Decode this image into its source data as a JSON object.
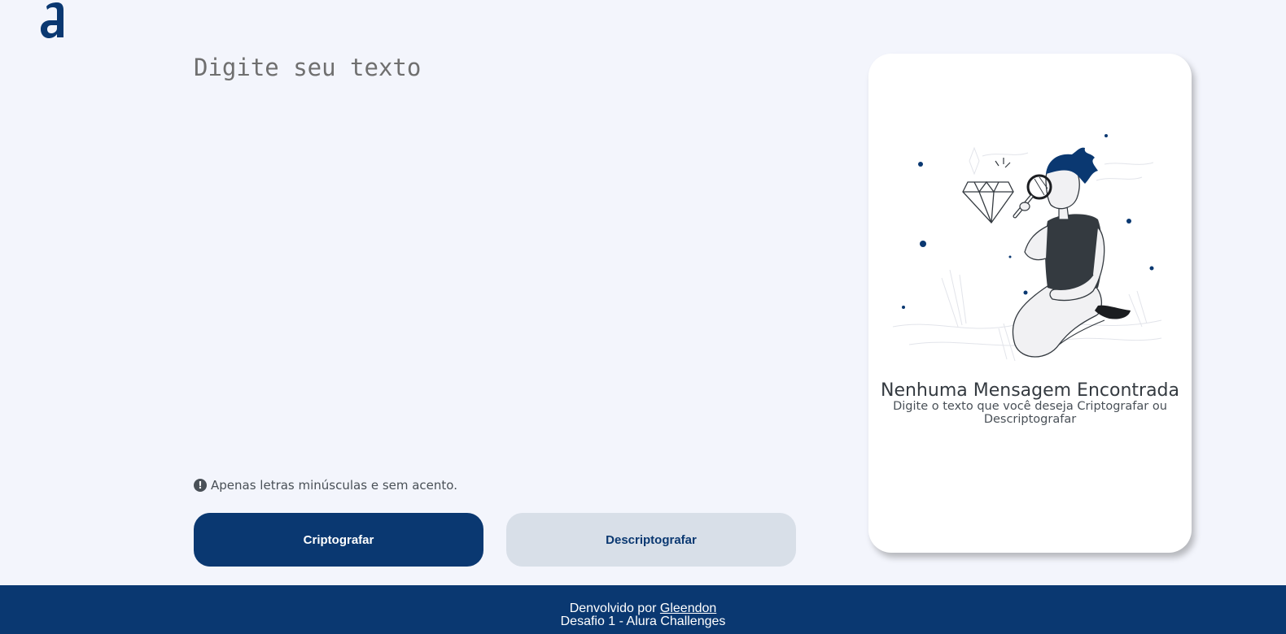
{
  "colors": {
    "background": "#f3f5fc",
    "primary": "#0a3871",
    "secondary_button": "#d8dfe8",
    "card": "#ffffff",
    "warning": "#495057"
  },
  "header": {
    "logo_icon": "alura-logo-icon"
  },
  "input": {
    "placeholder": "Digite seu texto",
    "value": ""
  },
  "warning": {
    "icon": "exclamation-circle-icon",
    "icon_glyph": "!",
    "text": "Apenas letras minúsculas e sem acento."
  },
  "buttons": {
    "encrypt_label": "Criptografar",
    "decrypt_label": "Descriptografar"
  },
  "output_card": {
    "illustration": "person-with-magnifier-illustration",
    "title": "Nenhuma Mensagem Encontrada",
    "text": "Digite o texto que você deseja Criptografar ou Descriptografar"
  },
  "footer": {
    "developed_by": "Denvolvido por",
    "author_link": "Gleendon",
    "challenge": "Desafio 1 - Alura Challenges"
  }
}
